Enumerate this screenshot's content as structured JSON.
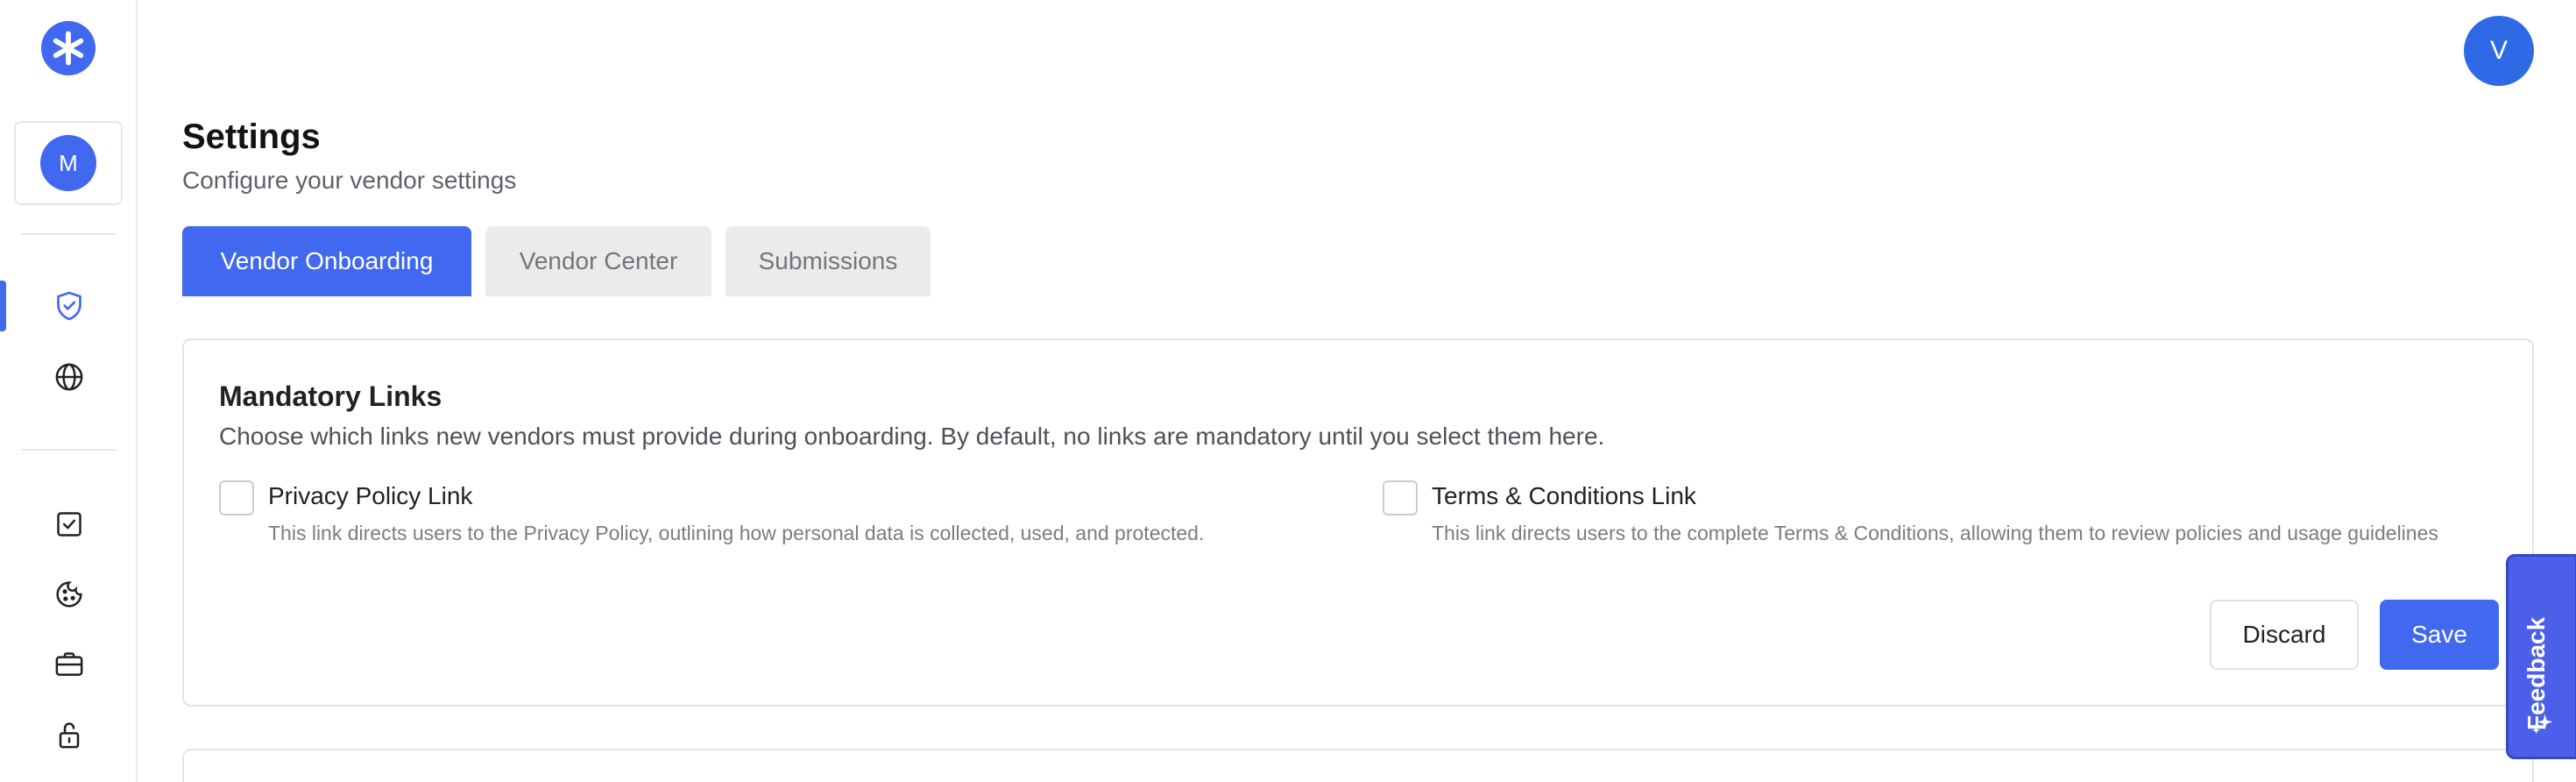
{
  "sidebar": {
    "logo_icon": "asterisk-logo-icon",
    "org_avatar_initial": "M",
    "nav_top": [
      {
        "icon": "shield-check-icon",
        "active": true
      },
      {
        "icon": "globe-icon",
        "active": false
      }
    ],
    "nav_bottom": [
      {
        "icon": "checkbox-icon"
      },
      {
        "icon": "cookie-icon"
      },
      {
        "icon": "briefcase-icon"
      },
      {
        "icon": "unlock-icon"
      }
    ]
  },
  "header": {
    "user_avatar_initial": "V",
    "title": "Settings",
    "subtitle": "Configure your vendor settings"
  },
  "tabs": [
    {
      "label": "Vendor Onboarding",
      "active": true
    },
    {
      "label": "Vendor Center",
      "active": false
    },
    {
      "label": "Submissions",
      "active": false
    }
  ],
  "mandatory_links": {
    "title": "Mandatory Links",
    "description": "Choose which links new vendors must provide during onboarding. By default, no links are mandatory until you select them here.",
    "options": [
      {
        "label": "Privacy Policy Link",
        "help": "This link directs users to the Privacy Policy, outlining how personal data is collected, used, and protected.",
        "checked": false
      },
      {
        "label": "Terms & Conditions Link",
        "help": "This link directs users to the complete Terms & Conditions, allowing them to review policies and usage guidelines",
        "checked": false
      }
    ],
    "discard_label": "Discard",
    "save_label": "Save"
  },
  "feedback": {
    "label": "Feedback",
    "icon": "sparkle-icon"
  },
  "colors": {
    "accent": "#4169f0",
    "feedback_bg": "#4b5fe8",
    "tab_inactive_bg": "#ebebeb"
  }
}
